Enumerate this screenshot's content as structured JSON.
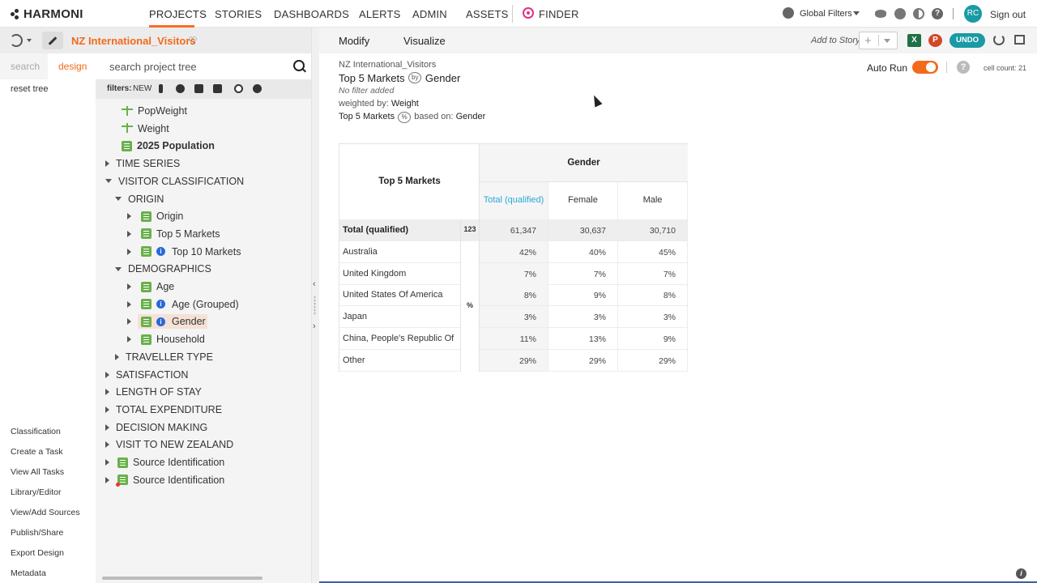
{
  "brand": "HARMONI",
  "nav": {
    "projects": "PROJECTS",
    "stories": "STORIES",
    "dashboards": "DASHBOARDS",
    "alerts": "ALERTS",
    "admin": "ADMIN",
    "assets": "ASSETS",
    "finder": "FINDER"
  },
  "topright": {
    "global_filters": "Global Filters",
    "avatar_initials": "RC",
    "signout": "Sign out",
    "help": "?"
  },
  "project": {
    "name": "NZ International_Visitors"
  },
  "left_tabs": {
    "search": "search",
    "design": "design",
    "reset_tree": "reset tree"
  },
  "tree_search": {
    "placeholder": "search project tree"
  },
  "filters": {
    "label": "filters:",
    "new": "NEW"
  },
  "tree": [
    {
      "label": "PopWeight",
      "level": 2,
      "kind": "weight"
    },
    {
      "label": "Weight",
      "level": 2,
      "kind": "weight"
    },
    {
      "label": "2025 Population",
      "level": 2,
      "kind": "var",
      "bold": true
    },
    {
      "label": "TIME SERIES",
      "level": 0,
      "kind": "folder",
      "open": false
    },
    {
      "label": "VISITOR CLASSIFICATION",
      "level": 0,
      "kind": "folder",
      "open": true
    },
    {
      "label": "ORIGIN",
      "level": 1,
      "kind": "folder",
      "open": true
    },
    {
      "label": "Origin",
      "level": 2,
      "kind": "var"
    },
    {
      "label": "Top 5 Markets",
      "level": 2,
      "kind": "var"
    },
    {
      "label": "Top 10 Markets",
      "level": 2,
      "kind": "var",
      "info": true
    },
    {
      "label": "DEMOGRAPHICS",
      "level": 1,
      "kind": "folder",
      "open": true
    },
    {
      "label": "Age",
      "level": 2,
      "kind": "var"
    },
    {
      "label": "Age (Grouped)",
      "level": 2,
      "kind": "var",
      "info": true
    },
    {
      "label": "Gender",
      "level": 2,
      "kind": "var",
      "info": true,
      "selected": true
    },
    {
      "label": "Household",
      "level": 2,
      "kind": "var"
    },
    {
      "label": "TRAVELLER TYPE",
      "level": 1,
      "kind": "folder",
      "open": false
    },
    {
      "label": "SATISFACTION",
      "level": 0,
      "kind": "folder",
      "open": false
    },
    {
      "label": "LENGTH OF STAY",
      "level": 0,
      "kind": "folder",
      "open": false
    },
    {
      "label": "TOTAL EXPENDITURE",
      "level": 0,
      "kind": "folder",
      "open": false
    },
    {
      "label": "DECISION MAKING",
      "level": 0,
      "kind": "folder",
      "open": false
    },
    {
      "label": "VISIT TO NEW ZEALAND",
      "level": 0,
      "kind": "folder",
      "open": false
    },
    {
      "label": "Source Identification",
      "level": 0,
      "kind": "var"
    },
    {
      "label": "Source Identification",
      "level": 0,
      "kind": "var",
      "red": true
    }
  ],
  "left_links": [
    "Classification",
    "Create a Task",
    "View All Tasks",
    "Library/Editor",
    "View/Add Sources",
    "Publish/Share",
    "Export Design",
    "Metadata"
  ],
  "main_toolbar": {
    "modify": "Modify",
    "visualize": "Visualize",
    "add_to_story": "Add to Story",
    "add_plus": "+",
    "excel": "X",
    "ppt": "P",
    "undo": "UNDO"
  },
  "info": {
    "project": "NZ International_Visitors",
    "row_var": "Top 5 Markets",
    "by_badge": "by",
    "col_var": "Gender",
    "no_filter": "No filter added",
    "weighted_prefix": "weighted by:",
    "weighted_value": "Weight",
    "pct_var": "Top 5 Markets",
    "pct_badge": "%",
    "based_on": "based on:",
    "based_value": "Gender"
  },
  "autorun": {
    "label": "Auto Run",
    "on": true,
    "help": "?",
    "cell_count": "cell count: 21"
  },
  "table": {
    "row_header": "Top 5 Markets",
    "col_header": "Gender",
    "columns": [
      "Total (qualified)",
      "Female",
      "Male"
    ],
    "unit_count": "123",
    "unit_pct": "%",
    "rows": [
      {
        "label": "Total (qualified)",
        "values": [
          "61,347",
          "30,637",
          "30,710"
        ],
        "total": true
      },
      {
        "label": "Australia",
        "values": [
          "42%",
          "40%",
          "45%"
        ]
      },
      {
        "label": "United Kingdom",
        "values": [
          "7%",
          "7%",
          "7%"
        ]
      },
      {
        "label": "United States Of America",
        "values": [
          "8%",
          "9%",
          "8%"
        ]
      },
      {
        "label": "Japan",
        "values": [
          "3%",
          "3%",
          "3%"
        ]
      },
      {
        "label": "China, People's Republic Of",
        "values": [
          "11%",
          "13%",
          "9%"
        ]
      },
      {
        "label": "Other",
        "values": [
          "29%",
          "29%",
          "29%"
        ]
      }
    ]
  },
  "colors": {
    "accent": "#f26a1b",
    "teal": "#1a9aa4",
    "link_blue": "#29a9d8"
  }
}
